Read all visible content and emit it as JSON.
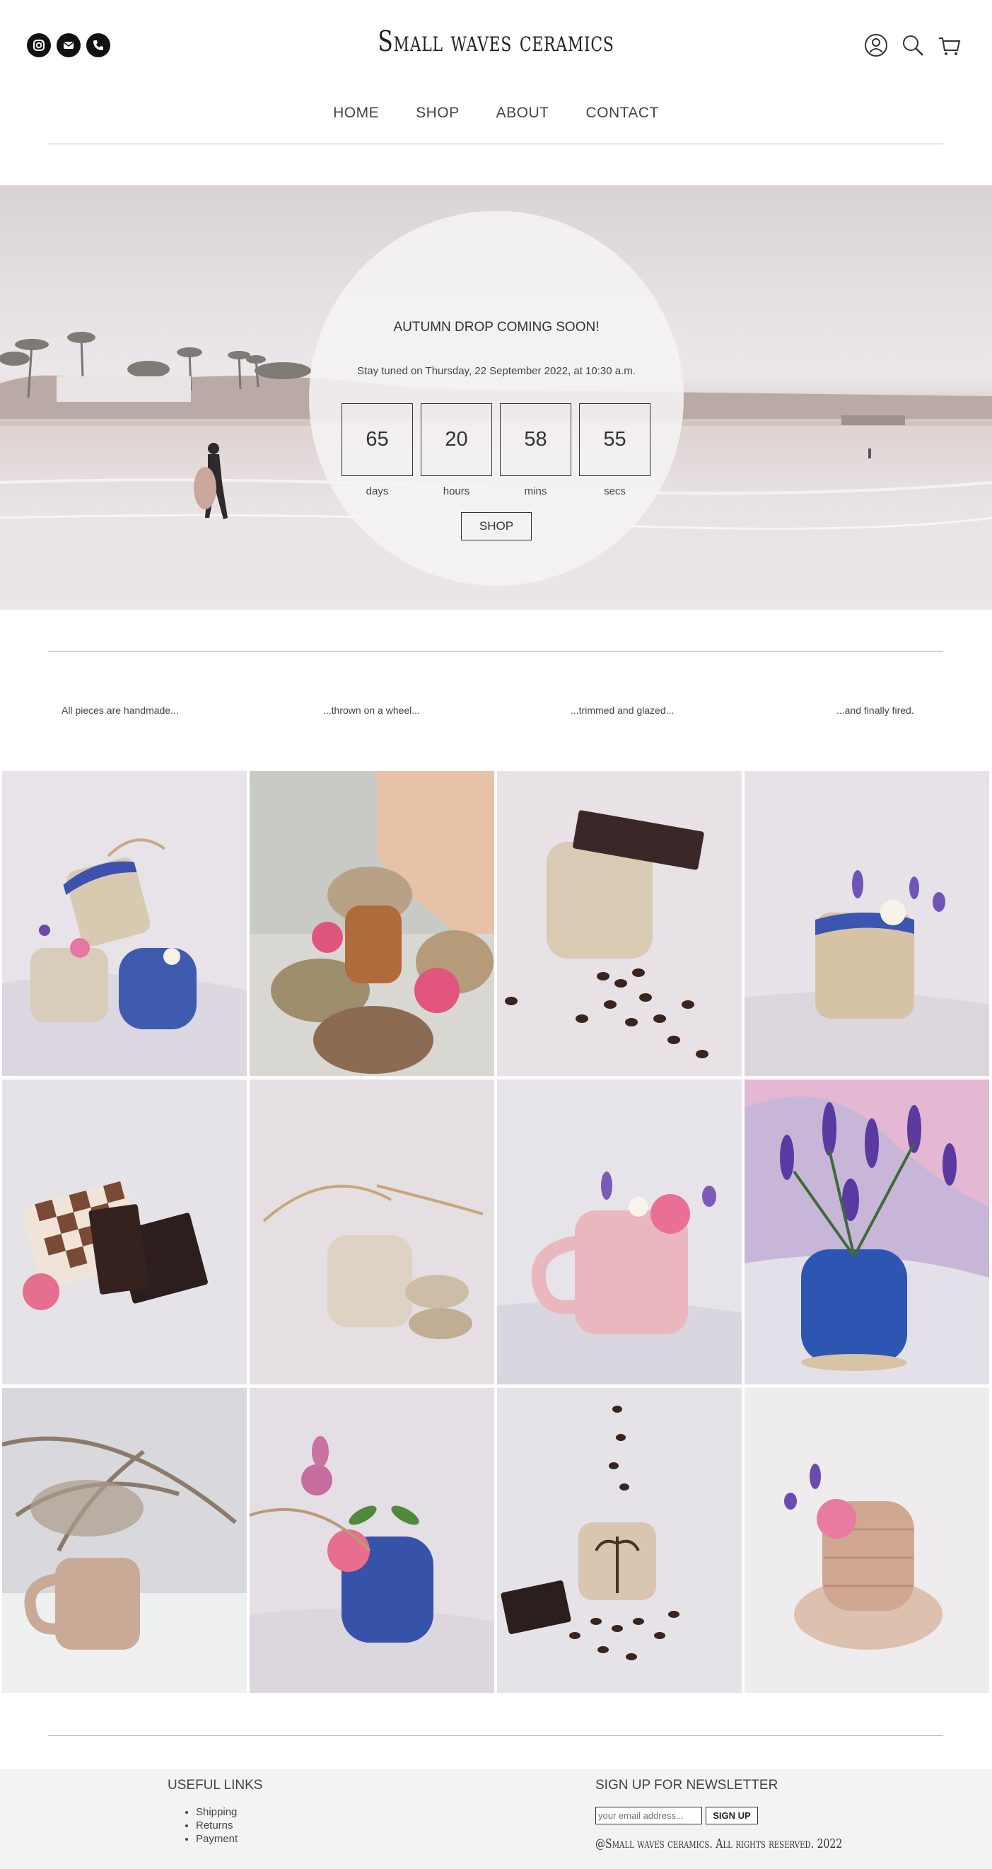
{
  "header": {
    "brand": "Small waves ceramics",
    "social": [
      {
        "icon": "instagram-icon"
      },
      {
        "icon": "mail-icon"
      },
      {
        "icon": "phone-icon"
      }
    ],
    "tools": [
      {
        "icon": "account-icon"
      },
      {
        "icon": "search-icon"
      },
      {
        "icon": "cart-icon"
      }
    ]
  },
  "nav": [
    "HOME",
    "SHOP",
    "ABOUT",
    "CONTACT"
  ],
  "hero": {
    "title": "AUTUMN DROP COMING SOON!",
    "subtitle": "Stay tuned on Thursday, 22 September 2022, at 10:30 a.m.",
    "countdown": [
      {
        "value": "65",
        "label": "days"
      },
      {
        "value": "20",
        "label": "hours"
      },
      {
        "value": "58",
        "label": "mins"
      },
      {
        "value": "55",
        "label": "secs"
      }
    ],
    "button": "SHOP"
  },
  "steps": [
    "All pieces are handmade...",
    "...thrown on a wheel...",
    "...trimmed and glazed...",
    "...and finally fired."
  ],
  "gallery": [
    {
      "name": "blue-drip-cups-with-grass"
    },
    {
      "name": "terracotta-cup-with-shells"
    },
    {
      "name": "textured-cup-with-chocolate"
    },
    {
      "name": "drip-cup-with-flowers"
    },
    {
      "name": "checkered-cup-with-chocolate"
    },
    {
      "name": "textured-cup-with-stones"
    },
    {
      "name": "pink-mug-with-flowers"
    },
    {
      "name": "blue-vase-with-lavender"
    },
    {
      "name": "nude-mug-with-pampas"
    },
    {
      "name": "blue-vase-with-roses"
    },
    {
      "name": "palm-mug-with-coffee-beans"
    },
    {
      "name": "ribbed-cup-on-shell"
    }
  ],
  "footer": {
    "links_title": "USEFUL LINKS",
    "links": [
      "Shipping",
      "Returns",
      "Payment"
    ],
    "newsletter_title": "SIGN UP FOR NEWSLETTER",
    "email_placeholder": "your email address...",
    "signup_button": "SIGN UP",
    "copyright": "@Small waves ceramics. All rights reserved. 2022"
  }
}
